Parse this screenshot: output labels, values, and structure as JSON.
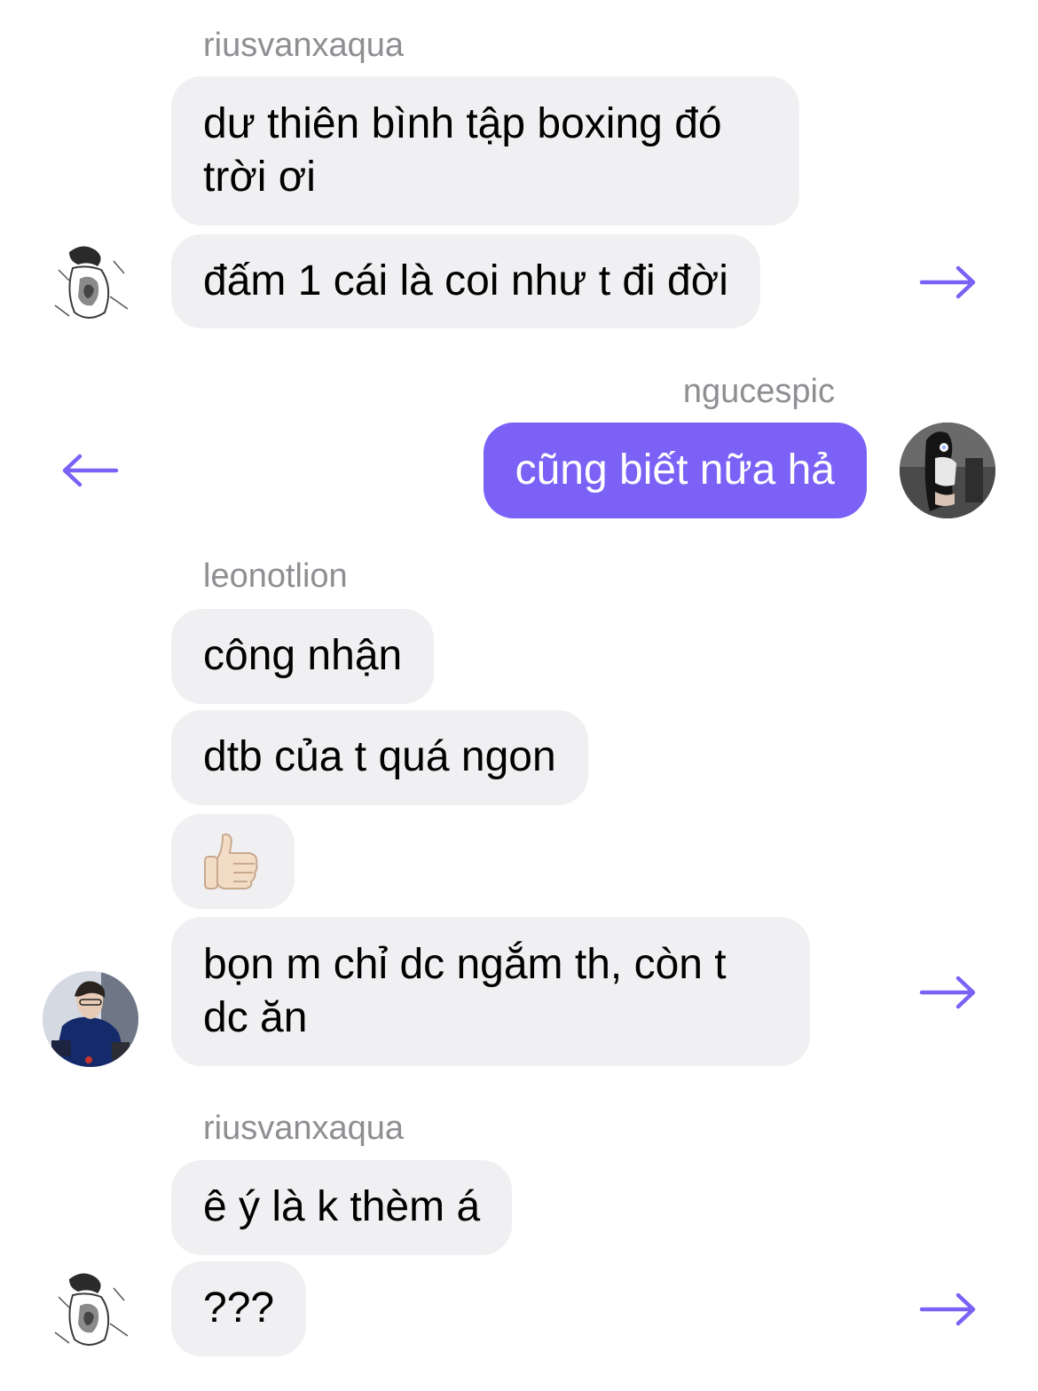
{
  "thread": {
    "group1": {
      "sender": "riusvanxaqua",
      "messages": [
        "dư thiên bình tập boxing đó trời ơi",
        "đấm 1 cái là coi như t đi đời"
      ]
    },
    "group2": {
      "sender": "ngucespic",
      "messages": [
        "cũng biết nữa hả"
      ]
    },
    "group3": {
      "sender": "leonotlion",
      "messages": [
        "công nhận",
        "dtb của t quá ngon",
        "👍🏻",
        "bọn m chỉ dc ngắm th, còn t dc ăn"
      ]
    },
    "group4": {
      "sender": "riusvanxaqua",
      "messages": [
        "ê ý là k thèm á",
        "???"
      ]
    }
  },
  "icons": {
    "share_right": "arrow-right-icon",
    "share_left": "arrow-left-icon",
    "thumbs_up": "thumbs-up-emoji"
  },
  "colors": {
    "accent": "#7b61f6",
    "incoming_bubble": "#f0f0f2",
    "sender_label": "#8e8e93"
  }
}
